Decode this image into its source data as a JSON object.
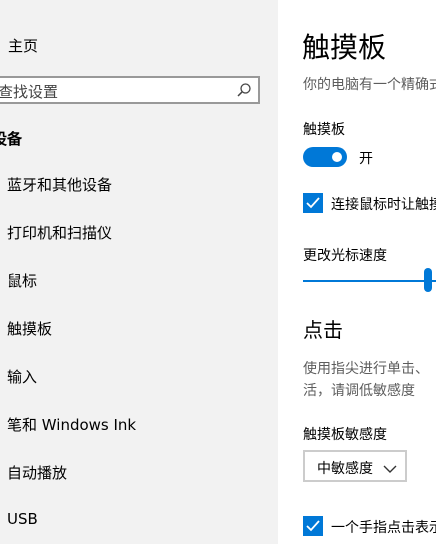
{
  "nav": {
    "home_label": "主页",
    "search_placeholder": "查找设置",
    "section_header": "设备",
    "items": [
      {
        "label": "蓝牙和其他设备"
      },
      {
        "label": "打印机和扫描仪"
      },
      {
        "label": "鼠标"
      },
      {
        "label": "触摸板"
      },
      {
        "label": "输入"
      },
      {
        "label": "笔和 Windows Ink"
      },
      {
        "label": "自动播放"
      },
      {
        "label": "USB"
      }
    ]
  },
  "content": {
    "page_title": "触摸板",
    "subtitle": "你的电脑有一个精确式触摸板",
    "touchpad_label": "触摸板",
    "toggle_state_text": "开",
    "toggle_on": true,
    "leave_on_with_mouse_label": "连接鼠标时让触摸板保持打开状态",
    "leave_on_with_mouse_checked": true,
    "cursor_speed_label": "更改光标速度",
    "taps_title": "点击",
    "taps_desc_line1": "使用指尖进行单击、",
    "taps_desc_line2": "活，请调低敏感度",
    "sensitivity_label": "触摸板敏感度",
    "sensitivity_value": "中敏感度",
    "single_tap_label": "一个手指点击表示单击",
    "single_tap_checked": true
  },
  "colors": {
    "accent": "#0078d7",
    "nav_bg": "#f2f2f2"
  },
  "icons": {
    "search": "search-icon",
    "dropdown": "chevron-down-icon",
    "check": "checkmark-icon"
  }
}
